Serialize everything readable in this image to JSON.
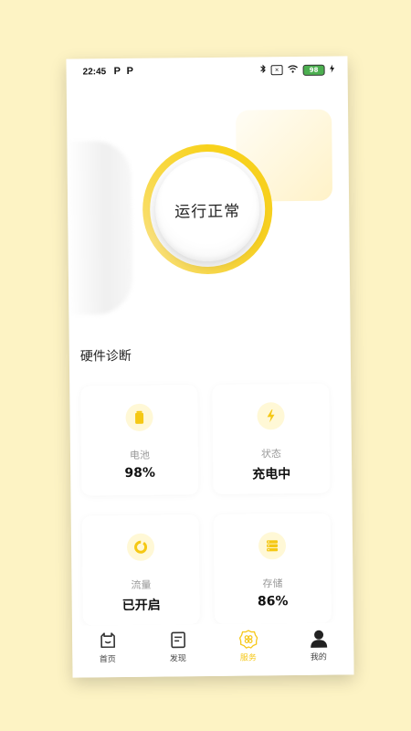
{
  "status_bar": {
    "time": "22:45",
    "carrier_icons": [
      "P",
      "P"
    ],
    "battery_level": "98"
  },
  "hero": {
    "status_text": "运行正常",
    "accent_color": "#f8d21c"
  },
  "diagnostics": {
    "title": "硬件诊断",
    "cards": [
      {
        "icon": "battery-icon",
        "label": "电池",
        "value": "98%"
      },
      {
        "icon": "lightning-icon",
        "label": "状态",
        "value": "充电中"
      },
      {
        "icon": "donut-icon",
        "label": "流量",
        "value": "已开启"
      },
      {
        "icon": "storage-icon",
        "label": "存储",
        "value": "86%"
      }
    ]
  },
  "tabbar": {
    "items": [
      {
        "label": "首页",
        "icon": "home-icon",
        "active": false
      },
      {
        "label": "发现",
        "icon": "discover-icon",
        "active": false
      },
      {
        "label": "服务",
        "icon": "service-icon",
        "active": true
      },
      {
        "label": "我的",
        "icon": "profile-icon",
        "active": false
      }
    ]
  }
}
